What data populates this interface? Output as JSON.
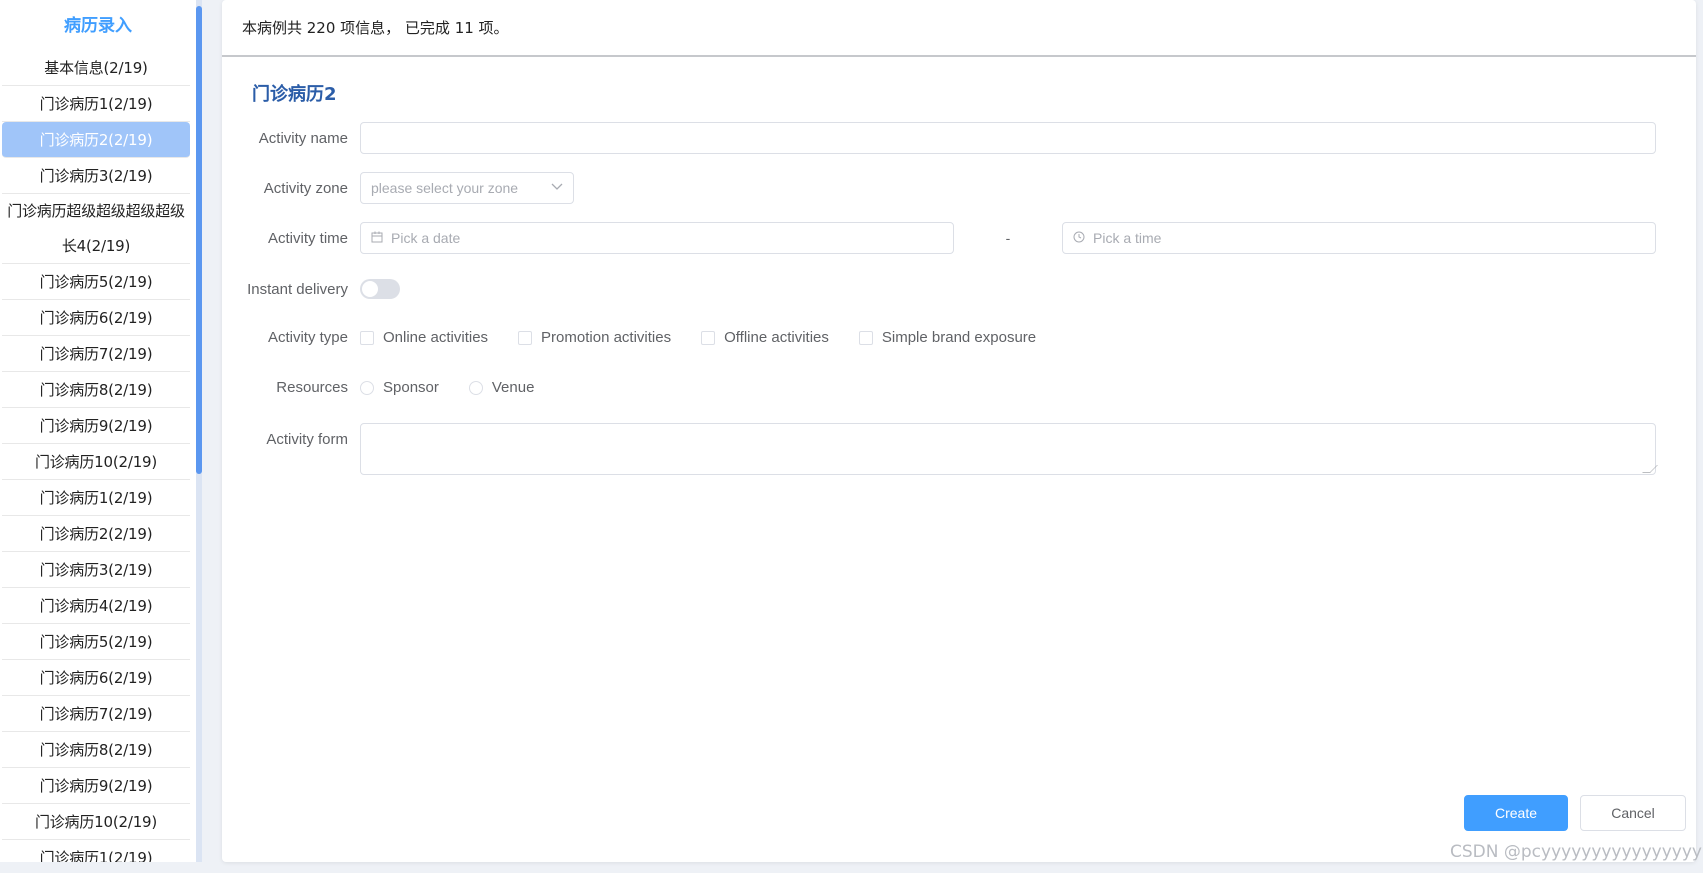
{
  "sidebar": {
    "title": "病历录入",
    "items": [
      {
        "label": "基本信息(2/19)"
      },
      {
        "label": "门诊病历1(2/19)"
      },
      {
        "label": "门诊病历2(2/19)"
      },
      {
        "label": "门诊病历3(2/19)"
      },
      {
        "label": "门诊病历超级超级超级超级长4(2/19)"
      },
      {
        "label": "门诊病历5(2/19)"
      },
      {
        "label": "门诊病历6(2/19)"
      },
      {
        "label": "门诊病历7(2/19)"
      },
      {
        "label": "门诊病历8(2/19)"
      },
      {
        "label": "门诊病历9(2/19)"
      },
      {
        "label": "门诊病历10(2/19)"
      },
      {
        "label": "门诊病历1(2/19)"
      },
      {
        "label": "门诊病历2(2/19)"
      },
      {
        "label": "门诊病历3(2/19)"
      },
      {
        "label": "门诊病历4(2/19)"
      },
      {
        "label": "门诊病历5(2/19)"
      },
      {
        "label": "门诊病历6(2/19)"
      },
      {
        "label": "门诊病历7(2/19)"
      },
      {
        "label": "门诊病历8(2/19)"
      },
      {
        "label": "门诊病历9(2/19)"
      },
      {
        "label": "门诊病历10(2/19)"
      },
      {
        "label": "门诊病历1(2/19)"
      }
    ],
    "active_index": 2
  },
  "header": {
    "summary": "本病例共 220 项信息， 已完成 11 项。"
  },
  "form": {
    "section_title": "门诊病历2",
    "activity_name": {
      "label": "Activity name",
      "value": ""
    },
    "activity_zone": {
      "label": "Activity zone",
      "placeholder": "please select your zone"
    },
    "activity_time": {
      "label": "Activity time",
      "date_placeholder": "Pick a date",
      "separator": "-",
      "time_placeholder": "Pick a time"
    },
    "instant_delivery": {
      "label": "Instant delivery",
      "enabled": false
    },
    "activity_type": {
      "label": "Activity type",
      "options": [
        "Online activities",
        "Promotion activities",
        "Offline activities",
        "Simple brand exposure"
      ]
    },
    "resources": {
      "label": "Resources",
      "options": [
        "Sponsor",
        "Venue"
      ]
    },
    "activity_form": {
      "label": "Activity form",
      "value": ""
    }
  },
  "actions": {
    "create_label": "Create",
    "cancel_label": "Cancel"
  },
  "watermark": "CSDN @pcyyyyyyyyyyyyyyyy",
  "colors": {
    "accent": "#409eff",
    "active_item": "#a0c5f9",
    "section_title": "#2b5da8"
  }
}
